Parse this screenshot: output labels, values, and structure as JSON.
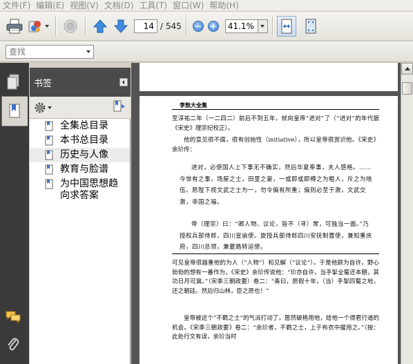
{
  "menu": {
    "items": [
      {
        "label": "文件(F)"
      },
      {
        "label": "编辑(E)"
      },
      {
        "label": "视图(V)"
      },
      {
        "label": "文档(D)"
      },
      {
        "label": "工具(T)"
      },
      {
        "label": "窗口(W)"
      },
      {
        "label": "帮助(H)"
      }
    ]
  },
  "toolbar": {
    "icons": [
      "printer-icon",
      "share-icon",
      "stamp-icon",
      "arrow-up-icon",
      "arrow-down-icon",
      "zoom-out-icon",
      "zoom-in-icon",
      "fit-width-icon",
      "fit-page-icon"
    ],
    "current_page": "14",
    "total_pages": "/ 545",
    "zoom_value": "41.1%",
    "zoom_out_symbol": "−",
    "zoom_in_symbol": "+"
  },
  "search": {
    "placeholder": "查找"
  },
  "sidebar": {
    "tabs": [
      "pages-icon",
      "bookmarks-icon",
      "comments-icon",
      "attachments-icon"
    ]
  },
  "bookmarks": {
    "title": "书签",
    "items": [
      {
        "label": "全集总目录"
      },
      {
        "label": "本书总目录"
      },
      {
        "label": "历史与人像",
        "selected": true
      },
      {
        "label": "教育与脸谱"
      },
      {
        "label": "为中国思想趋向求答案"
      }
    ]
  },
  "document": {
    "running_header": "李敖大全集",
    "paragraph1": "至淳祐二年（一二四二）前后不到五年，就向皇帝“进对”了（“进对”的年代据《宋史》理宗纪校正）。",
    "paragraph2": "他的意见很不腐，很有创始性（initiative），所以皇帝很赏识他。《宋史》余玠传：",
    "quote1": "进对，必使国人上下事无不确实，然后华夏奉事，夫人感格。……今世有之事，场屋之士，田里之豪，一或即或即樽之为粗人，斥之为啥伍。愿陛下视文武之士为一，勿令偏有所重；偏则必至于激，文武交激，非国之福。",
    "quote2": "帝（理宗）曰：“卿人物、议论，皆不（寻）常，可独当一面。”乃授权兵部侍郎，四川宣谕使。旋授兵部侍郎四川安抚制置使，兼知重庆府，四川总领，兼夔路转运使。",
    "paragraph3": "可见皇帝很器重他的为人（“人物”）和见解（“议论”）。于是他颇为自许，野心勃勃的想有一番作为，《宋史》余玠传说他：“玠亦自许，当手掣全蜀还本朝，其功日月可冀。”（宋季三朝政要）卷二：“奏曰，愿假十年，（当）手掣四蜀之地，还之朝廷。然后归山林，臣之愿也！”",
    "paragraph4": "皇帝被这个“不羁之士”的气派打动了，居然破格用他，给他一个得君行道的机会。《宋季三朝政要》卷二：“余玠者，不羁之士，上于布衣中擢用之。”（按：此处行文有误，余玠当时"
  }
}
